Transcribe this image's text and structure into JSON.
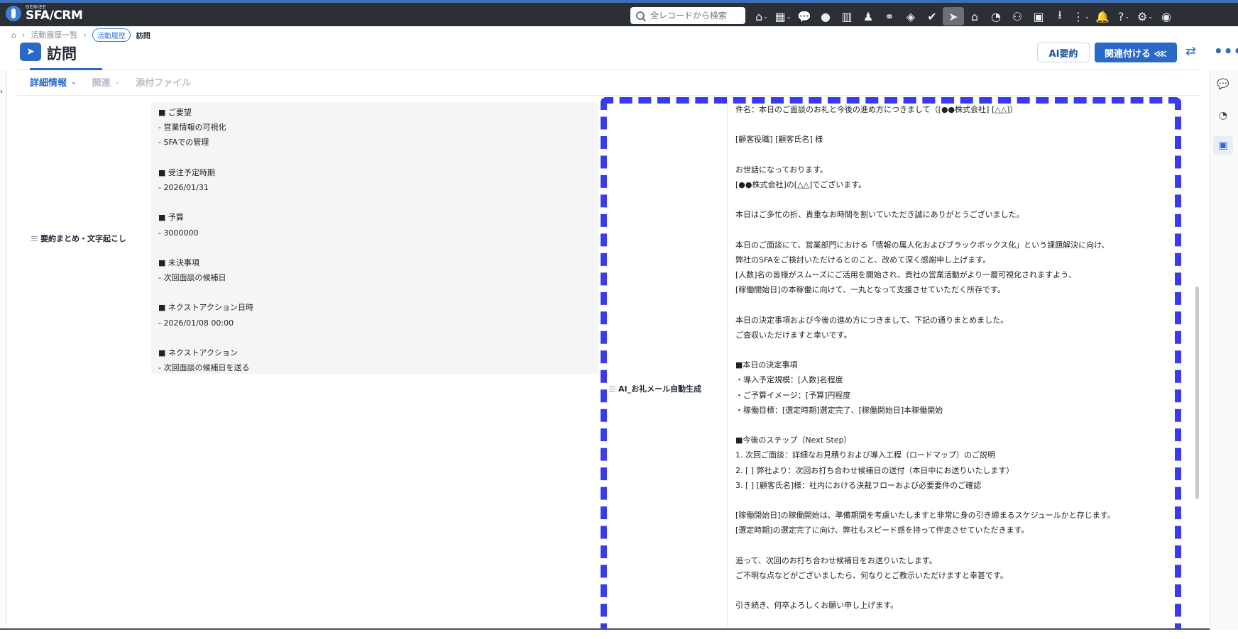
{
  "brand": {
    "small": "GENIEE",
    "name": "SFA/CRM"
  },
  "search": {
    "placeholder": "全レコードから検索"
  },
  "topbar_icons": [
    "home-icon",
    "apps-icon",
    "chat-icon",
    "drop-icon",
    "building-icon",
    "person-icon",
    "handshake-icon",
    "box-icon",
    "check-icon",
    "visit-icon",
    "store-icon",
    "chart-icon",
    "group-icon",
    "cube-icon",
    "download-icon",
    "more-vertical-icon",
    "bell-icon",
    "help-icon",
    "settings-icon",
    "avatar-icon"
  ],
  "breadcrumb": {
    "parent": "活動履歴一覧",
    "chip": "活動履歴",
    "current": "訪問"
  },
  "page": {
    "title": "訪問"
  },
  "actions": {
    "ai_summary": "AI要約",
    "link": "関連付ける"
  },
  "tabs": [
    {
      "label": "詳細情報"
    },
    {
      "label": "関連"
    },
    {
      "label": "添付ファイル"
    }
  ],
  "fields": {
    "summary_label": "要約まとめ・文字起こし",
    "mail_label": "AI_お礼メール自動生成"
  },
  "summary_lines": [
    "■ ご要望",
    "- 営業情報の可視化",
    "- SFAでの管理",
    "",
    "■ 受注予定時期",
    "- 2026/01/31",
    "",
    "■ 予算",
    "- 3000000",
    "",
    "■ 未決事項",
    "- 次回面談の候補日",
    "",
    "■ ネクストアクション日時",
    "- 2026/01/08 00:00",
    "",
    "■ ネクストアクション",
    "- 次回面談の候補日を送る"
  ],
  "mail_lines": [
    "件名：本日のご面談のお礼と今後の進め方につきまして（[●●株式会社] [△△]）",
    "",
    "[顧客役職] [顧客氏名] 様",
    "",
    "お世話になっております。",
    "[●●株式会社]の[△△]でございます。",
    "",
    "本日はご多忙の折、貴重なお時間を割いていただき誠にありがとうございました。",
    "",
    "本日のご面談にて、営業部門における「情報の属人化およびブラックボックス化」という課題解決に向け、",
    "弊社のSFAをご検討いただけるとのこと、改めて深く感謝申し上げます。",
    "[人数]名の皆様がスムーズにご活用を開始され、貴社の営業活動がより一層可視化されますよう、",
    "[稼働開始日]の本稼働に向けて、一丸となって支援させていただく所存です。",
    "",
    "本日の決定事項および今後の進め方につきまして、下記の通りまとめました。",
    "ご査収いただけますと幸いです。",
    "",
    "■本日の決定事項",
    "・導入予定規模：[人数]名程度",
    "・ご予算イメージ：[予算]円程度",
    "・稼働目標：[選定時期]選定完了、[稼働開始日]本稼働開始",
    "",
    "■今後のステップ（Next Step）",
    "1. 次回ご面談：詳細なお見積りおよび導入工程（ロードマップ）のご説明",
    "2. [ ] 弊社より：次回お打ち合わせ候補日の送付（本日中にお送りいたします）",
    "3. [ ] [顧客氏名]様：社内における決裁フローおよび必要要件のご確認",
    "",
    "[稼働開始日]の稼働開始は、準備期間を考慮いたしますと非常に身の引き締まるスケジュールかと存じます。",
    "[選定時期]の選定完了に向け、弊社もスピード感を持って伴走させていただきます。",
    "",
    "追って、次回のお打ち合わせ候補日をお送りいたします。",
    "ご不明な点などがございましたら、何なりとご教示いただけますと幸甚です。",
    "",
    "引き続き、何卒よろしくお願い申し上げます。"
  ],
  "colors": {
    "accent": "#2a69c6",
    "topbar": "#2b2f36",
    "highlight": "#3a3af0"
  }
}
